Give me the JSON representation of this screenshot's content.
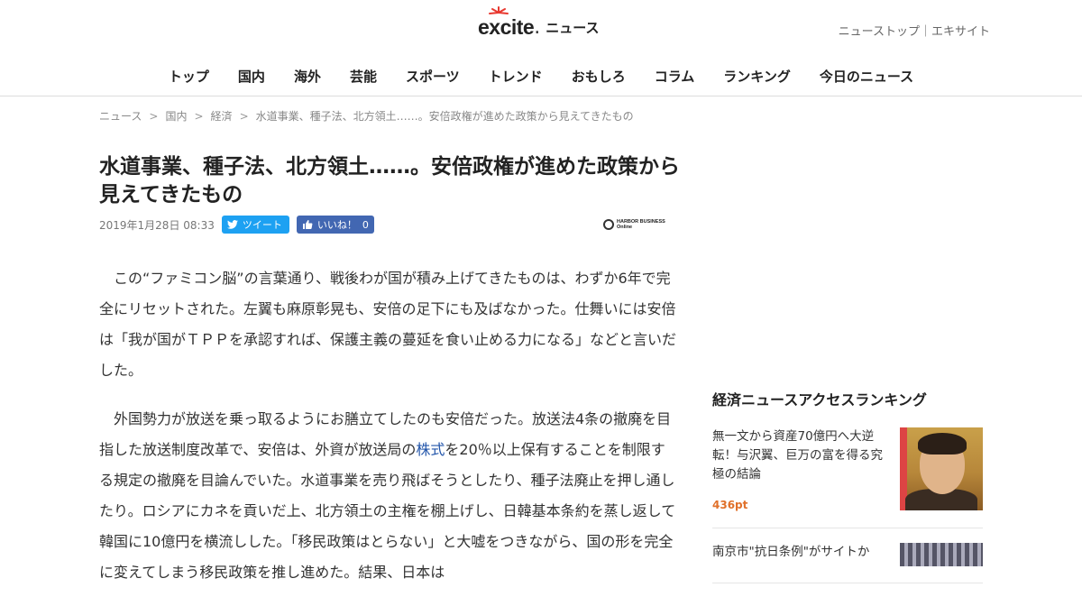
{
  "header": {
    "brand": "excite",
    "section": "ニュース",
    "top_links": [
      "ニューストップ",
      "エキサイト"
    ],
    "top_links_sep": "｜"
  },
  "nav": [
    "トップ",
    "国内",
    "海外",
    "芸能",
    "スポーツ",
    "トレンド",
    "おもしろ",
    "コラム",
    "ランキング",
    "今日のニュース"
  ],
  "breadcrumb": [
    "ニュース",
    "国内",
    "経済",
    "水道事業、種子法、北方領土……。安倍政権が進めた政策から見えてきたもの"
  ],
  "breadcrumb_sep": ">",
  "article": {
    "title": "水道事業、種子法、北方領土……。安倍政権が進めた政策から見えてきたもの",
    "date": "2019年1月28日 08:33",
    "tweet_label": "ツイート",
    "like_label": "いいね！",
    "like_count": "0",
    "source_logo_text": [
      "HARBOR BUSINESS",
      "Online"
    ],
    "p1": "この“ファミコン脳”の言葉通り、戦後わが国が積み上げてきたものは、わずか6年で完全にリセットされた。左翼も麻原彰晃も、安倍の足下にも及ばなかった。仕舞いには安倍は「我が国がＴＰＰを承認すれば、保護主義の蔓延を食い止める力になる」などと言いだした。",
    "p2_before": "外国勢力が放送を乗っ取るようにお膳立てしたのも安倍だった。放送法4条の撤廃を目指した放送制度改革で、安倍は、外資が放送局の",
    "p2_link": "株式",
    "p2_after": "を20％以上保有することを制限する規定の撤廃を目論んでいた。水道事業を売り飛ばそうとしたり、種子法廃止を押し通したり。ロシアにカネを貢いだ上、北方領土の主権を棚上げし、日韓基本条約を蒸し返して韓国に10億円を横流しした。「移民政策はとらない」と大嘘をつきながら、国の形を完全に変えてしまう移民政策を推し進めた。結果、日本は"
  },
  "ranking": {
    "heading": "経済ニュースアクセスランキング",
    "items": [
      {
        "title": "無一文から資産70億円へ大逆転！与沢翼、巨万の富を得る究極の結論",
        "points": "436pt"
      },
      {
        "title": "南京市\"抗日条例\"がサイトか",
        "points": ""
      }
    ]
  },
  "colors": {
    "accent_orange": "#e0702a",
    "twitter": "#1da1f2",
    "facebook": "#4267b2",
    "link": "#2255aa"
  }
}
